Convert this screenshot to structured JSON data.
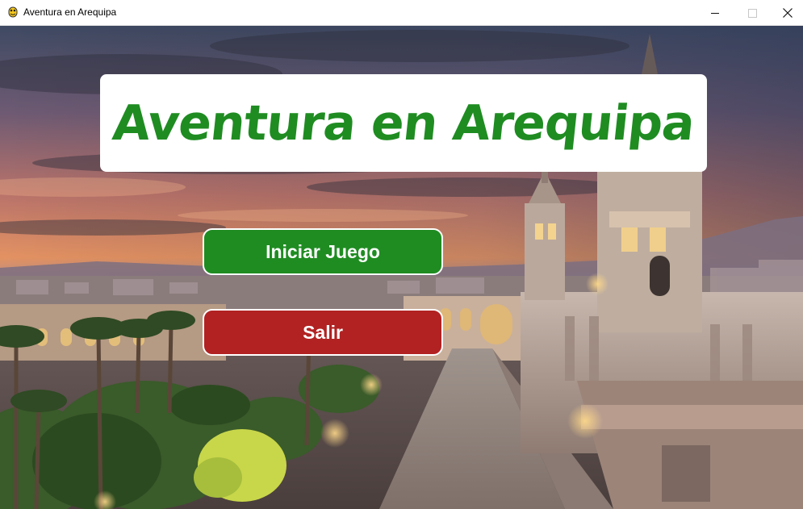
{
  "window": {
    "title": "Aventura en Arequipa",
    "icon": "pygame-snake-icon",
    "controls": [
      "minimize",
      "maximize",
      "close"
    ]
  },
  "game": {
    "title": "Aventura en Arequipa",
    "background": "arequipa-plaza-de-armas-sunset-image",
    "buttons": {
      "start_label": "Iniciar Juego",
      "exit_label": "Salir"
    }
  },
  "colors": {
    "title_green": "#1f8c22",
    "start_button": "#1f8c22",
    "exit_button": "#b22222",
    "card_bg": "#ffffff"
  }
}
